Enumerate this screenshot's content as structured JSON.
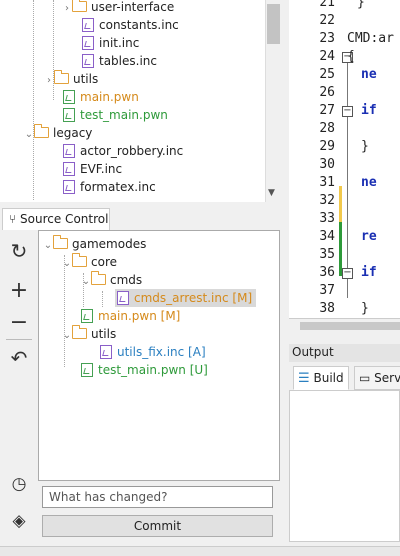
{
  "file_tree": [
    {
      "label": "user-interface",
      "kind": "folder",
      "color": "default"
    },
    {
      "label": "constants.inc",
      "kind": "file",
      "color": "default"
    },
    {
      "label": "init.inc",
      "kind": "file",
      "color": "default"
    },
    {
      "label": "tables.inc",
      "kind": "file",
      "color": "default"
    },
    {
      "label": "utils",
      "kind": "folder",
      "color": "default"
    },
    {
      "label": "main.pwn",
      "kind": "file",
      "color": "orange"
    },
    {
      "label": "test_main.pwn",
      "kind": "file",
      "color": "green"
    },
    {
      "label": "legacy",
      "kind": "folder",
      "color": "default"
    },
    {
      "label": "actor_robbery.inc",
      "kind": "file",
      "color": "default"
    },
    {
      "label": "EVF.inc",
      "kind": "file",
      "color": "default"
    },
    {
      "label": "formatex.inc",
      "kind": "file",
      "color": "default"
    }
  ],
  "editor": {
    "lines": [
      {
        "num": "21",
        "code": "}"
      },
      {
        "num": "22",
        "code": ""
      },
      {
        "num": "23",
        "code": "CMD:ar"
      },
      {
        "num": "24",
        "code": "{"
      },
      {
        "num": "25",
        "code": "    ne"
      },
      {
        "num": "26",
        "code": ""
      },
      {
        "num": "27",
        "code": "    if"
      },
      {
        "num": "28",
        "code": ""
      },
      {
        "num": "29",
        "code": "    }"
      },
      {
        "num": "30",
        "code": ""
      },
      {
        "num": "31",
        "code": "    ne"
      },
      {
        "num": "32",
        "code": ""
      },
      {
        "num": "33",
        "code": ""
      },
      {
        "num": "34",
        "code": "    re"
      },
      {
        "num": "35",
        "code": ""
      },
      {
        "num": "36",
        "code": "    if"
      },
      {
        "num": "37",
        "code": ""
      },
      {
        "num": "38",
        "code": "    }"
      }
    ],
    "colors": {
      "modified": "#f2c94c",
      "added": "#2e9a3a",
      "keyword": "#1a2fb3"
    }
  },
  "output": {
    "title": "Output",
    "tabs": [
      "Build",
      "Serve"
    ]
  },
  "source_control": {
    "tab_label": "Source Control",
    "tree": [
      {
        "label": "gamemodes",
        "kind": "folder",
        "status": ""
      },
      {
        "label": "core",
        "kind": "folder",
        "status": ""
      },
      {
        "label": "cmds",
        "kind": "folder",
        "status": ""
      },
      {
        "label": "cmds_arrest.inc [M]",
        "kind": "file",
        "status": "M"
      },
      {
        "label": "main.pwn [M]",
        "kind": "file",
        "status": "M"
      },
      {
        "label": "utils",
        "kind": "folder",
        "status": ""
      },
      {
        "label": "utils_fix.inc [A]",
        "kind": "file",
        "status": "A"
      },
      {
        "label": "test_main.pwn [U]",
        "kind": "file",
        "status": "U"
      }
    ],
    "commit_placeholder": "What has changed?",
    "commit_label": "Commit"
  }
}
